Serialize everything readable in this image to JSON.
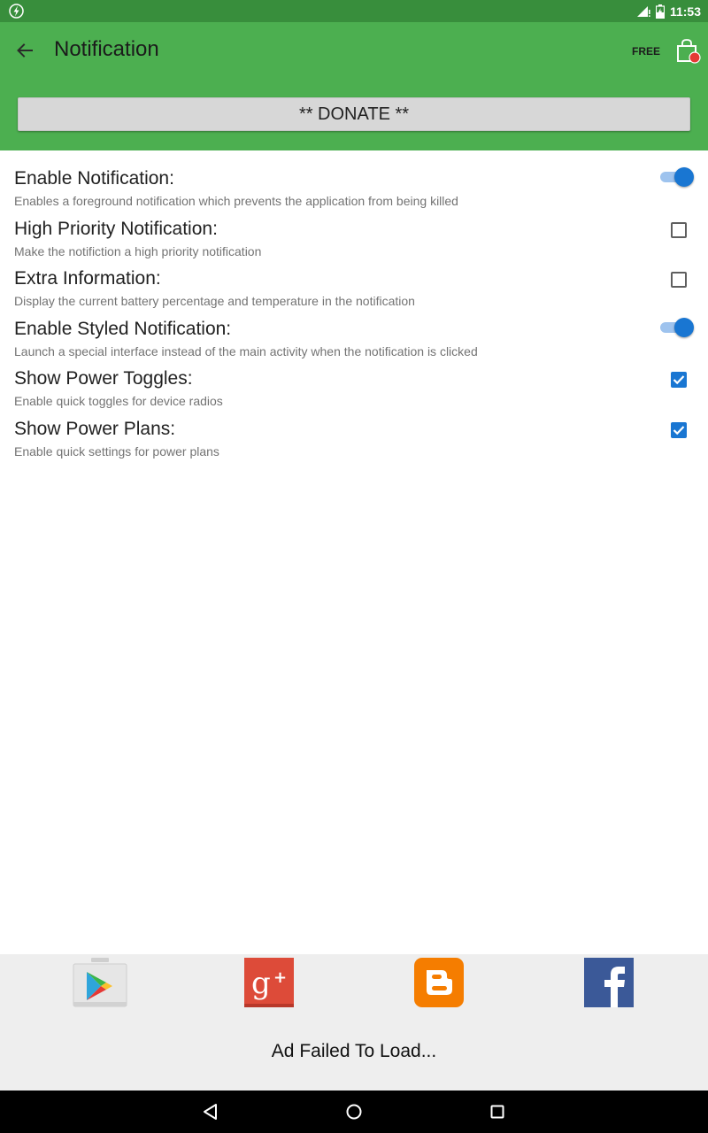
{
  "status_bar": {
    "time": "11:53"
  },
  "app_bar": {
    "title": "Notification",
    "free_label": "FREE",
    "donate_label": "** DONATE **",
    "background": "#4caf50",
    "status_color": "#388e3c"
  },
  "settings": [
    {
      "title": "Enable Notification:",
      "summary": "Enables a foreground notification which prevents the application from being killed",
      "control": "switch",
      "checked": true
    },
    {
      "title": "High Priority Notification:",
      "summary": "Make the notifiction a high priority notification",
      "control": "checkbox",
      "checked": false
    },
    {
      "title": "Extra Information:",
      "summary": "Display the current battery percentage and temperature in the notification",
      "control": "checkbox",
      "checked": false
    },
    {
      "title": "Enable Styled Notification:",
      "summary": "Launch a special interface instead of the main activity when the notification is clicked",
      "control": "switch",
      "checked": true
    },
    {
      "title": "Show Power Toggles:",
      "summary": "Enable quick toggles for device radios",
      "control": "checkbox",
      "checked": true
    },
    {
      "title": "Show Power Plans:",
      "summary": "Enable quick settings for power plans",
      "control": "checkbox",
      "checked": true
    }
  ],
  "social": {
    "icons": [
      "play-store-icon",
      "google-plus-icon",
      "blogger-icon",
      "facebook-icon"
    ],
    "ad_text": "Ad Failed To Load..."
  },
  "accent_color": "#1976d2"
}
